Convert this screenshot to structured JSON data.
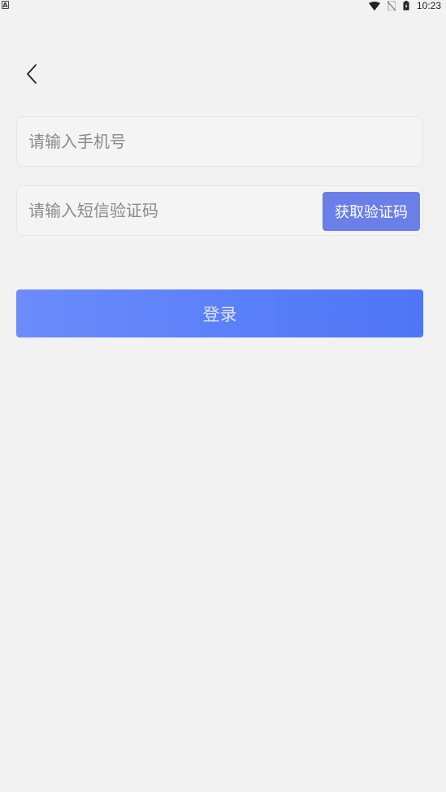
{
  "status_bar": {
    "app_icon_letter": "A",
    "time": "10:23",
    "icons": [
      "wifi-icon",
      "no-sim-icon",
      "battery-charging-icon"
    ]
  },
  "header": {
    "back_icon": "chevron-left-icon"
  },
  "form": {
    "phone_placeholder": "请输入手机号",
    "phone_value": "",
    "code_placeholder": "请输入短信验证码",
    "code_value": "",
    "get_code_label": "获取验证码",
    "login_label": "登录"
  },
  "colors": {
    "background": "#f2f2f3",
    "get_code_button": "#6b7fe8",
    "login_gradient_start": "#6c8cfb",
    "login_gradient_end": "#4f76f6"
  }
}
